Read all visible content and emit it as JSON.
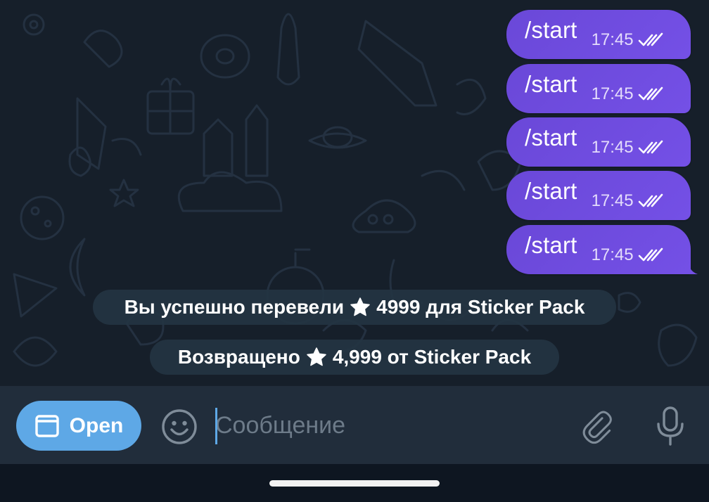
{
  "messages": [
    {
      "text": "/start",
      "time": "17:45"
    },
    {
      "text": "/start",
      "time": "17:45"
    },
    {
      "text": "/start",
      "time": "17:45"
    },
    {
      "text": "/start",
      "time": "17:45"
    },
    {
      "text": "/start",
      "time": "17:45"
    }
  ],
  "service_messages": [
    {
      "before": "Вы успешно перевели",
      "after": "4999 для Sticker Pack",
      "icon": "star-icon"
    },
    {
      "before": "Возвращено",
      "after": "4,999 от Sticker Pack",
      "icon": "star-icon"
    }
  ],
  "composer": {
    "open_label": "Open",
    "placeholder": "Сообщение",
    "icons": [
      "web-app-icon",
      "emoji-icon",
      "paperclip-icon",
      "microphone-icon"
    ]
  },
  "colors": {
    "chat_background": "#161f2a",
    "outgoing_bubble": "#6a48d8",
    "service_pill": "#243442",
    "composer_background": "#212d3b",
    "open_button": "#5ea8e6"
  }
}
